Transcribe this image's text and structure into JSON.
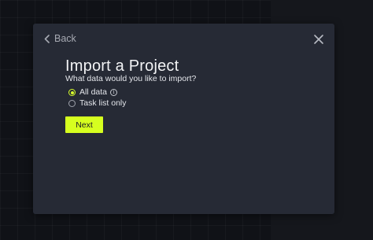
{
  "modal": {
    "back_label": "Back",
    "title": "Import a Project",
    "subtitle": "What data would you like to import?",
    "options": [
      {
        "label": "All data",
        "selected": true,
        "has_info_icon": true
      },
      {
        "label": "Task list only",
        "selected": false,
        "has_info_icon": false
      }
    ],
    "info_glyph": "i",
    "next_label": "Next"
  },
  "colors": {
    "accent": "#d6ff1f",
    "modal_background": "#262a35",
    "page_background": "#101217"
  },
  "icons": {
    "back": "chevron-left-icon",
    "close": "close-icon",
    "info": "info-icon"
  }
}
